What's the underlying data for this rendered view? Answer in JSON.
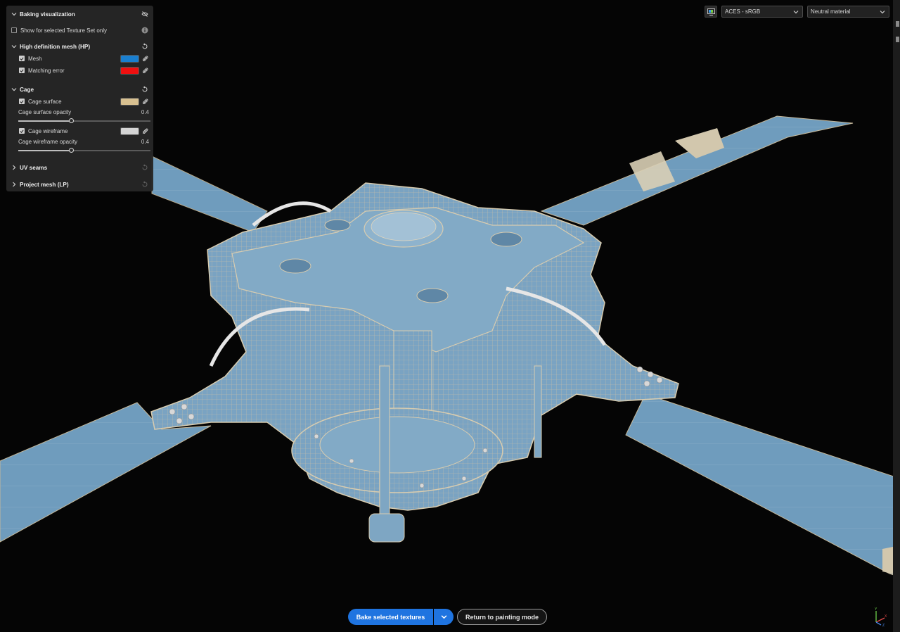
{
  "panel": {
    "title": "Baking visualization",
    "show_selected_only": {
      "label": "Show for selected Texture Set only",
      "checked": false
    },
    "hp_section": {
      "title": "High definition mesh (HP)",
      "items": [
        {
          "label": "Mesh",
          "checked": true,
          "color": "#1a7fcf"
        },
        {
          "label": "Matching error",
          "checked": true,
          "color": "#f01010"
        }
      ]
    },
    "cage_section": {
      "title": "Cage",
      "surface": {
        "label": "Cage surface",
        "checked": true,
        "color": "#d8c090"
      },
      "surface_opacity": {
        "label": "Cage surface opacity",
        "value": "0.4",
        "fraction": 0.4
      },
      "wireframe": {
        "label": "Cage wireframe",
        "checked": true,
        "color": "#d4d4d4"
      },
      "wireframe_opacity": {
        "label": "Cage wireframe opacity",
        "value": "0.4",
        "fraction": 0.4
      }
    },
    "uv_seams": {
      "title": "UV seams"
    },
    "project_mesh": {
      "title": "Project mesh (LP)"
    }
  },
  "toolbar": {
    "display_icon": "display-settings-icon",
    "color_profile": "ACES - sRGB",
    "material": "Neutral material"
  },
  "actions": {
    "bake_label": "Bake selected textures",
    "return_label": "Return to painting mode"
  },
  "axis_labels": {
    "x": "X",
    "y": "Y",
    "z": "Z"
  },
  "colors": {
    "accent": "#1f74e0",
    "mesh_blue": "#6f9fc0",
    "cage_tan": "#cbb89a",
    "background": "#050505"
  }
}
